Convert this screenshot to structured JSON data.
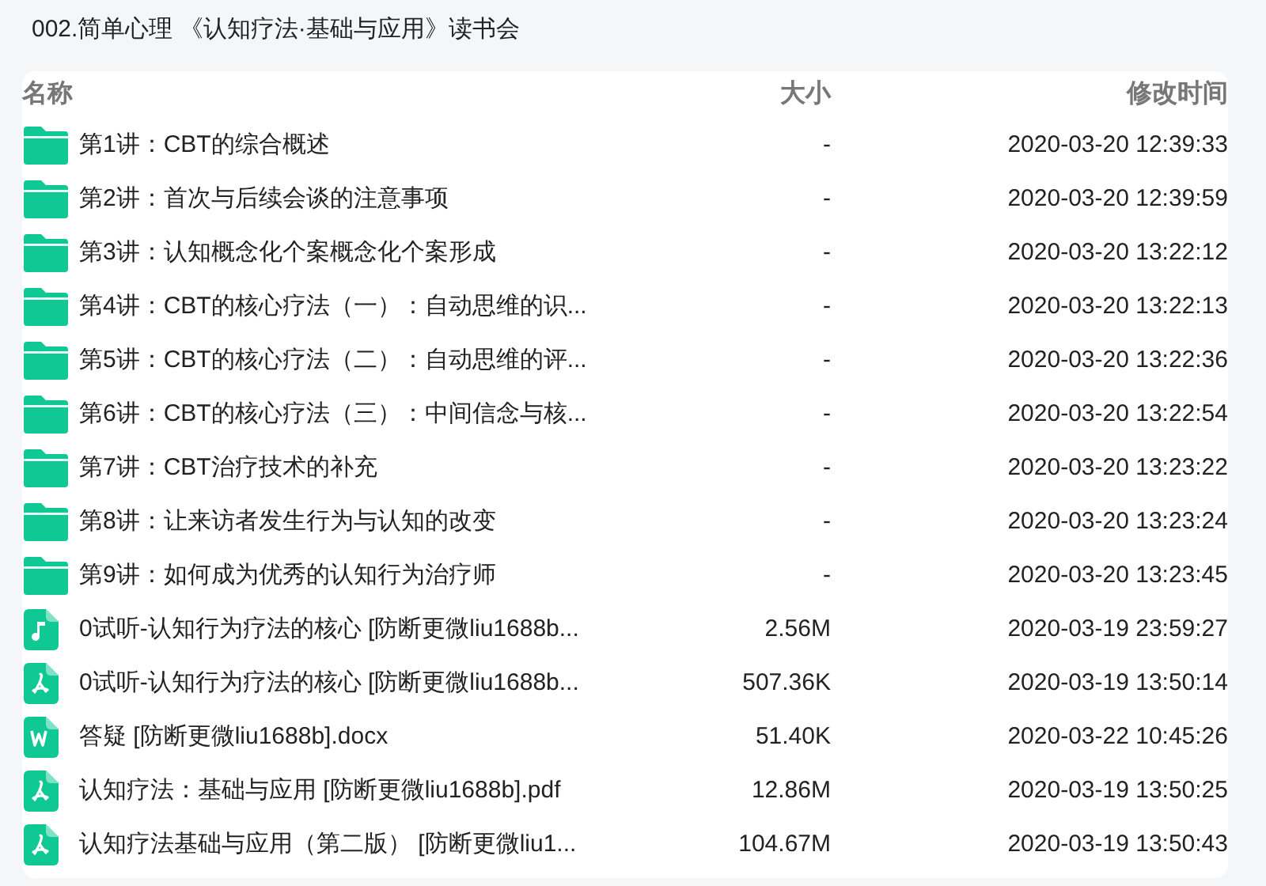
{
  "title": "002.简单心理 《认知疗法·基础与应用》读书会",
  "table": {
    "columns": [
      "名称",
      "大小",
      "修改时间"
    ],
    "rows": [
      {
        "kind": "folder",
        "name": "第1讲：CBT的综合概述",
        "size": "-",
        "modified": "2020-03-20 12:39:33"
      },
      {
        "kind": "folder",
        "name": "第2讲：首次与后续会谈的注意事项",
        "size": "-",
        "modified": "2020-03-20 12:39:59"
      },
      {
        "kind": "folder",
        "name": "第3讲：认知概念化个案概念化个案形成",
        "size": "-",
        "modified": "2020-03-20 13:22:12"
      },
      {
        "kind": "folder",
        "name": "第4讲：CBT的核心疗法（一）：自动思维的识...",
        "size": "-",
        "modified": "2020-03-20 13:22:13"
      },
      {
        "kind": "folder",
        "name": "第5讲：CBT的核心疗法（二）：自动思维的评...",
        "size": "-",
        "modified": "2020-03-20 13:22:36"
      },
      {
        "kind": "folder",
        "name": "第6讲：CBT的核心疗法（三）：中间信念与核...",
        "size": "-",
        "modified": "2020-03-20 13:22:54"
      },
      {
        "kind": "folder",
        "name": "第7讲：CBT治疗技术的补充",
        "size": "-",
        "modified": "2020-03-20 13:23:22"
      },
      {
        "kind": "folder",
        "name": "第8讲：让来访者发生行为与认知的改变",
        "size": "-",
        "modified": "2020-03-20 13:23:24"
      },
      {
        "kind": "folder",
        "name": "第9讲：如何成为优秀的认知行为治疗师",
        "size": "-",
        "modified": "2020-03-20 13:23:45"
      },
      {
        "kind": "audio",
        "name": "0试听-认知行为疗法的核心 [防断更微liu1688b...",
        "size": "2.56M",
        "modified": "2020-03-19 23:59:27"
      },
      {
        "kind": "pdf",
        "name": "0试听-认知行为疗法的核心 [防断更微liu1688b...",
        "size": "507.36K",
        "modified": "2020-03-19 13:50:14"
      },
      {
        "kind": "word",
        "name": "答疑 [防断更微liu1688b].docx",
        "size": "51.40K",
        "modified": "2020-03-22 10:45:26"
      },
      {
        "kind": "pdf",
        "name": "认知疗法：基础与应用 [防断更微liu1688b].pdf",
        "size": "12.86M",
        "modified": "2020-03-19 13:50:25"
      },
      {
        "kind": "pdf",
        "name": "认知疗法基础与应用（第二版） [防断更微liu1...",
        "size": "104.67M",
        "modified": "2020-03-19 13:50:43"
      }
    ]
  }
}
